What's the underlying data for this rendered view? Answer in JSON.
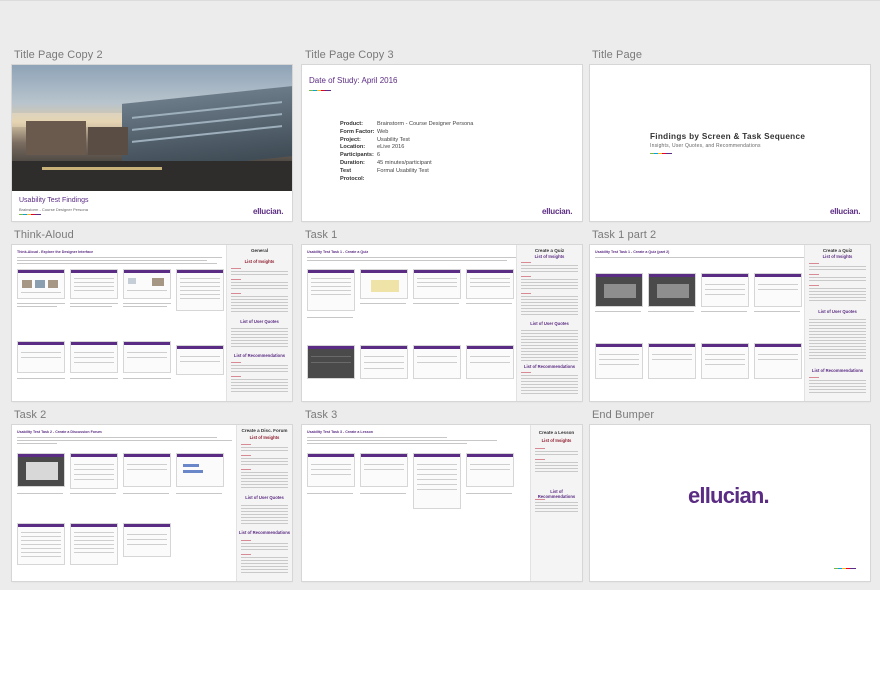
{
  "app": {
    "canvas_background": "#ececec",
    "brand_color": "#5b2c83"
  },
  "artboards": [
    {
      "label": "Title Page Copy 2",
      "title": "Usability Test Findings",
      "subtitle": "Brainstorm - Course Designer Persona",
      "logo": "ellucian."
    },
    {
      "label": "Title Page Copy 3",
      "date": "Date of Study:  April 2016",
      "meta": [
        {
          "key": "Product:",
          "value": "Brainstorm - Course Designer Persona"
        },
        {
          "key": "Form Factor:",
          "value": "Web"
        },
        {
          "key": "Project:",
          "value": "Usability Test"
        },
        {
          "key": "Location:",
          "value": "eLive 2016"
        },
        {
          "key": "Participants:",
          "value": "6"
        },
        {
          "key": "Duration:",
          "value": "45 minutes/participant"
        },
        {
          "key": "Test Protocol:",
          "value": "Formal Usability Test"
        }
      ],
      "logo": "ellucian."
    },
    {
      "label": "Title Page",
      "title": "Findings by Screen & Task Sequence",
      "subtitle": "Insights, User Quotes, and Recommendations",
      "logo": "ellucian."
    },
    {
      "label": "Think-Aloud",
      "heading": "Think-Aloud - Explore the Designer Interface",
      "side_title": "General",
      "side_sections": [
        "List of Insights",
        "List of User Quotes",
        "List of Recommendations"
      ]
    },
    {
      "label": "Task 1",
      "heading": "Usability Test Task 1 - Create a Quiz",
      "side_title": "Create a Quiz",
      "side_sections": [
        "List of Insights",
        "List of User Quotes",
        "List of Recommendations"
      ]
    },
    {
      "label": "Task 1 part 2",
      "heading": "Usability Test Task 1 - Create a Quiz (part 2)",
      "side_title": "Create a Quiz",
      "side_sections": [
        "List of Insights",
        "List of User Quotes",
        "List of Recommendations"
      ]
    },
    {
      "label": "Task 2",
      "heading": "Usability Test Task 2 - Create a Discussion Forum",
      "side_title": "Create a Disc. Forum",
      "side_sections": [
        "List of Insights",
        "List of User Quotes",
        "List of Recommendations"
      ]
    },
    {
      "label": "Task 3",
      "heading": "Usability Test Task 3 - Create a Lesson",
      "side_title": "Create a Lesson",
      "side_sections": [
        "List of Insights",
        "List of Recommendations"
      ]
    },
    {
      "label": "End Bumper",
      "logo": "ellucian."
    }
  ]
}
